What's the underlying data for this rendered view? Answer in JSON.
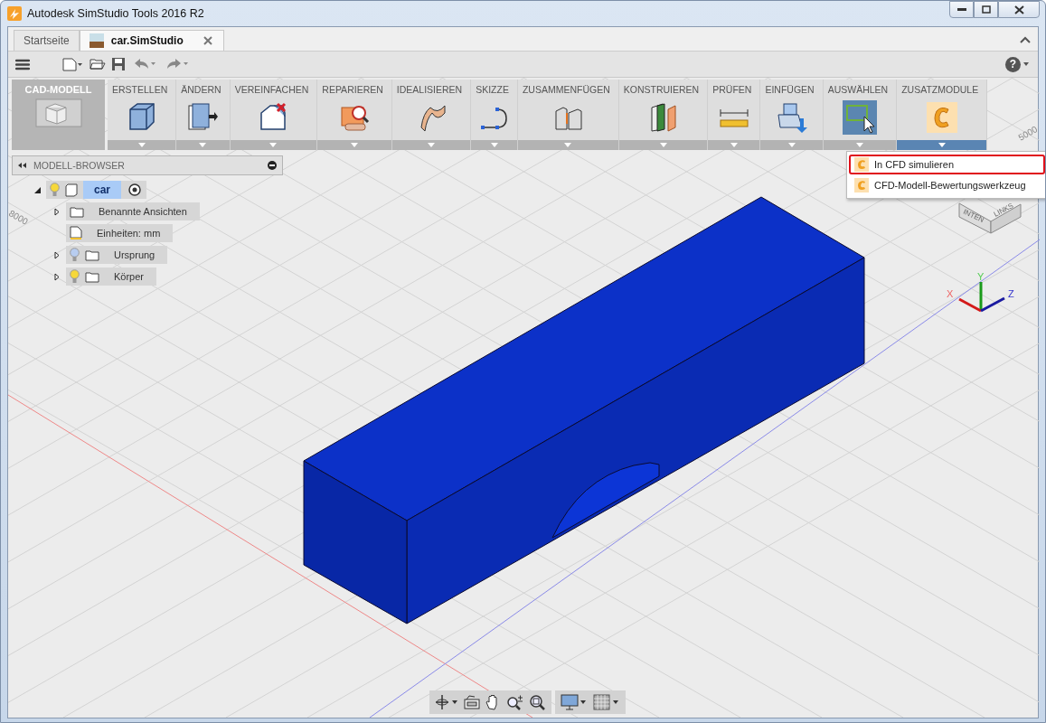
{
  "window": {
    "title": "Autodesk SimStudio Tools 2016 R2"
  },
  "tabs": [
    {
      "label": "Startseite",
      "selected": false
    },
    {
      "label": "car.SimStudio",
      "selected": true
    }
  ],
  "workspace": {
    "label": "CAD-MODELL"
  },
  "ribbon": [
    {
      "label": "ERSTELLEN",
      "kind": "box",
      "active": false,
      "selected": false
    },
    {
      "label": "ÄNDERN",
      "kind": "modify",
      "active": false,
      "selected": false
    },
    {
      "label": "VEREINFACHEN",
      "kind": "simplify",
      "active": false,
      "selected": false
    },
    {
      "label": "REPARIEREN",
      "kind": "repair",
      "active": false,
      "selected": false
    },
    {
      "label": "IDEALISIEREN",
      "kind": "surface",
      "active": false,
      "selected": false
    },
    {
      "label": "SKIZZE",
      "kind": "sketch",
      "active": false,
      "selected": false
    },
    {
      "label": "ZUSAMMENFÜGEN",
      "kind": "joint",
      "active": false,
      "selected": false
    },
    {
      "label": "KONSTRUIEREN",
      "kind": "plane",
      "active": false,
      "selected": false
    },
    {
      "label": "PRÜFEN",
      "kind": "ruler",
      "active": false,
      "selected": false
    },
    {
      "label": "EINFÜGEN",
      "kind": "insert",
      "active": false,
      "selected": false
    },
    {
      "label": "AUSWÄHLEN",
      "kind": "select",
      "active": true,
      "selected": false
    },
    {
      "label": "ZUSATZMODULE",
      "kind": "addin",
      "active": false,
      "selected": true
    }
  ],
  "dropdown_menu": [
    {
      "label": "In CFD simulieren",
      "highlighted": true
    },
    {
      "label": "CFD-Modell-Bewertungswerkzeug",
      "highlighted": false
    }
  ],
  "browser": {
    "title": "MODELL-BROWSER",
    "root": {
      "label": "car",
      "selected": true,
      "expanded": true,
      "children": [
        {
          "label": "Benannte Ansichten",
          "kind": "folder",
          "expandable": true
        },
        {
          "label": "Einheiten: mm",
          "kind": "units",
          "expandable": false
        },
        {
          "label": "Ursprung",
          "kind": "folder",
          "expandable": true,
          "visible": false
        },
        {
          "label": "Körper",
          "kind": "folder",
          "expandable": true,
          "visible": true
        }
      ]
    }
  },
  "help": {
    "label": "?"
  },
  "grid_labels": [
    "8000",
    "5000"
  ],
  "view_cube": {
    "faces": [
      "INTEN",
      "LINKS"
    ]
  },
  "axes": [
    "X",
    "Y",
    "Z"
  ]
}
